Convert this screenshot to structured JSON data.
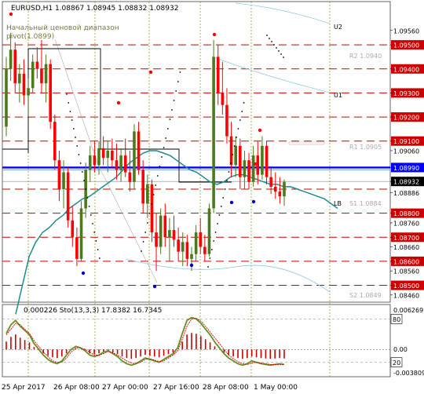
{
  "header": {
    "symbol_line": "EURUSD,H1  1.08867 1.08945 1.08832 1.08932",
    "indicator_name_1": "Начальный ценовой диапазон",
    "indicator_name_2": "pivot(1.0899)"
  },
  "subwindow": {
    "indicator_text": "0.000226  Sto(13,3,3) 17.8382 16.7345",
    "axis_ticks": [
      "0.006269",
      "0.00",
      "-0.003809"
    ],
    "levels": [
      "80",
      "20"
    ]
  },
  "colors": {
    "bull_candle": "#4a7a1a",
    "bear_candle": "#ff0000",
    "ma_teal": "#1e8c8c",
    "level_red": "#cc0000",
    "blue_line": "#0000ff",
    "stoch_main": "#6b8e23",
    "stoch_signal": "#cc0000",
    "fractal_red": "#ff0000",
    "fractal_blue": "#0000cc",
    "gridline": "#8c8c00"
  },
  "chart_data": {
    "type": "candlestick",
    "symbol": "EURUSD",
    "timeframe": "H1",
    "ohlc_last": {
      "open": 1.08867,
      "high": 1.08945,
      "low": 1.08832,
      "close": 1.08932
    },
    "ylim": [
      1.0843,
      1.0968
    ],
    "y_ticks": [
      1.0956,
      1.095,
      1.094,
      1.093,
      1.092,
      1.091,
      1.0906,
      1.0899,
      1.08932,
      1.08886,
      1.088,
      1.0876,
      1.087,
      1.0866,
      1.086,
      1.0856,
      1.085,
      1.0846
    ],
    "y_tick_labels": [
      "1.09560",
      "1.09500",
      "1.09400",
      "1.09300",
      "1.09200",
      "1.09100",
      "1.09060",
      "1.08990",
      "1.08932",
      "1.08886",
      "1.08800",
      "1.08760",
      "1.08700",
      "1.08660",
      "1.08600",
      "1.08560",
      "1.08500",
      "1.08460"
    ],
    "highlighted_ticks": [
      "1.09500",
      "1.09400",
      "1.09300",
      "1.09200",
      "1.09100",
      "1.08800",
      "1.08700",
      "1.08600",
      "1.08500"
    ],
    "blue_tick": "1.08990",
    "dark_tick": "1.08932",
    "x_labels": [
      "25 Apr 2017",
      "26 Apr 08:00",
      "27 Apr 00:00",
      "27 Apr 16:00",
      "28 Apr 08:00",
      "1 May 00:00"
    ],
    "horizontal_levels": [
      1.095,
      1.094,
      1.093,
      1.092,
      1.091,
      1.089,
      1.088,
      1.087,
      1.086,
      1.085
    ],
    "blue_line_level": 1.0899,
    "text_labels": [
      {
        "text": "U2",
        "level": 1.095
      },
      {
        "text": "U1",
        "level": 1.0925
      },
      {
        "text": "LB",
        "level": 1.0882
      },
      {
        "text": "R2 1.0940",
        "level": 1.094
      },
      {
        "text": "R1 1.0905",
        "level": 1.0905
      },
      {
        "text": "S1 1.0884",
        "level": 1.0884
      },
      {
        "text": "S2 1.0849",
        "level": 1.0849
      }
    ],
    "candles": [
      [
        1.0916,
        1.0945,
        1.0912,
        1.094
      ],
      [
        1.094,
        1.0955,
        1.0935,
        1.0948
      ],
      [
        1.0948,
        1.0951,
        1.093,
        1.0934
      ],
      [
        1.0934,
        1.0942,
        1.0926,
        1.0938
      ],
      [
        1.0938,
        1.0944,
        1.0925,
        1.0929
      ],
      [
        1.0929,
        1.0936,
        1.092,
        1.0932
      ],
      [
        1.0932,
        1.0946,
        1.093,
        1.0943
      ],
      [
        1.0943,
        1.0949,
        1.0936,
        1.094
      ],
      [
        1.094,
        1.0952,
        1.093,
        1.0934
      ],
      [
        1.0934,
        1.0946,
        1.0926,
        1.0942
      ],
      [
        1.0942,
        1.0944,
        1.0915,
        1.0918
      ],
      [
        1.0918,
        1.0921,
        1.0898,
        1.0902
      ],
      [
        1.0902,
        1.0906,
        1.0885,
        1.089
      ],
      [
        1.089,
        1.0902,
        1.0882,
        1.0897
      ],
      [
        1.0897,
        1.0899,
        1.0874,
        1.0877
      ],
      [
        1.0877,
        1.0883,
        1.0866,
        1.087
      ],
      [
        1.087,
        1.0874,
        1.0858,
        1.0861
      ],
      [
        1.0861,
        1.0885,
        1.086,
        1.0882
      ],
      [
        1.0882,
        1.0901,
        1.0878,
        1.0898
      ],
      [
        1.0898,
        1.0908,
        1.0893,
        1.0904
      ],
      [
        1.0904,
        1.091,
        1.0897,
        1.09
      ],
      [
        1.09,
        1.091,
        1.0896,
        1.0907
      ],
      [
        1.0907,
        1.0912,
        1.09,
        1.0903
      ],
      [
        1.0903,
        1.091,
        1.0897,
        1.0906
      ],
      [
        1.0906,
        1.0911,
        1.0899,
        1.0902
      ],
      [
        1.0902,
        1.0909,
        1.0894,
        1.0898
      ],
      [
        1.0898,
        1.0907,
        1.0893,
        1.0904
      ],
      [
        1.0904,
        1.0911,
        1.0895,
        1.0897
      ],
      [
        1.0897,
        1.0906,
        1.0889,
        1.0893
      ],
      [
        1.0893,
        1.0917,
        1.089,
        1.0914
      ],
      [
        1.0914,
        1.0918,
        1.0896,
        1.0898
      ],
      [
        1.0898,
        1.0902,
        1.088,
        1.0884
      ],
      [
        1.0884,
        1.0896,
        1.0878,
        1.0892
      ],
      [
        1.0892,
        1.0894,
        1.0868,
        1.0872
      ],
      [
        1.0872,
        1.088,
        1.0856,
        1.0866
      ],
      [
        1.0866,
        1.0882,
        1.0863,
        1.0879
      ],
      [
        1.0879,
        1.0884,
        1.0866,
        1.087
      ],
      [
        1.087,
        1.0878,
        1.086,
        1.0873
      ],
      [
        1.0873,
        1.0879,
        1.0866,
        1.0869
      ],
      [
        1.0869,
        1.0874,
        1.086,
        1.0864
      ],
      [
        1.0864,
        1.0872,
        1.0858,
        1.0868
      ],
      [
        1.0868,
        1.0871,
        1.0858,
        1.0861
      ],
      [
        1.0861,
        1.0866,
        1.0856,
        1.0863
      ],
      [
        1.0863,
        1.0875,
        1.086,
        1.0872
      ],
      [
        1.0872,
        1.0878,
        1.0863,
        1.0866
      ],
      [
        1.0866,
        1.0871,
        1.086,
        1.0863
      ],
      [
        1.0863,
        1.0884,
        1.0862,
        1.0882
      ],
      [
        1.0882,
        1.0952,
        1.088,
        1.0945
      ],
      [
        1.0945,
        1.095,
        1.0925,
        1.093
      ],
      [
        1.093,
        1.0943,
        1.0921,
        1.0925
      ],
      [
        1.0925,
        1.0932,
        1.0909,
        1.0912
      ],
      [
        1.0912,
        1.0918,
        1.0895,
        1.09
      ],
      [
        1.09,
        1.0912,
        1.0895,
        1.0908
      ],
      [
        1.0908,
        1.0911,
        1.089,
        1.0895
      ],
      [
        1.0895,
        1.0906,
        1.089,
        1.0902
      ],
      [
        1.0902,
        1.0905,
        1.089,
        1.0893
      ],
      [
        1.0893,
        1.0908,
        1.0891,
        1.0904
      ],
      [
        1.0904,
        1.091,
        1.0892,
        1.0896
      ],
      [
        1.0896,
        1.0912,
        1.0894,
        1.0908
      ],
      [
        1.0908,
        1.091,
        1.0892,
        1.0895
      ],
      [
        1.0895,
        1.0899,
        1.0888,
        1.0891
      ],
      [
        1.0891,
        1.0897,
        1.0886,
        1.0889
      ],
      [
        1.0889,
        1.0895,
        1.0884,
        1.0887
      ],
      [
        1.0887,
        1.0894,
        1.0883,
        1.0893
      ]
    ],
    "series": [
      {
        "values": [
          1.0838,
          1.085,
          1.0862,
          1.0868,
          1.0872,
          1.0874,
          1.0877,
          1.0879,
          1.0882,
          1.0884,
          1.0886,
          1.0887,
          1.0889,
          1.0891,
          1.0893,
          1.0895,
          1.0898,
          1.0901,
          1.0903,
          1.0905,
          1.0906,
          1.0906,
          1.0905,
          1.0904,
          1.0902,
          1.09,
          1.0898,
          1.0897,
          1.0895,
          1.0893,
          1.0892,
          1.0893,
          1.0895,
          1.0896,
          1.0896,
          1.0895,
          1.0894,
          1.0893,
          1.0892,
          1.0892,
          1.0891,
          1.0891,
          1.089,
          1.0889,
          1.0888,
          1.0887,
          1.0886,
          1.0884,
          1.0882
        ]
      }
    ],
    "subwindow_macd_range": [
      -0.003809,
      0.006269
    ],
    "stochastic_main": [
      60,
      72,
      78,
      70,
      64,
      58,
      46,
      38,
      30,
      24,
      20,
      18,
      22,
      30,
      38,
      42,
      40,
      36,
      30,
      28,
      30,
      34,
      36,
      32,
      28,
      22,
      18,
      16,
      18,
      22,
      26,
      24,
      22,
      20,
      24,
      28,
      32,
      40,
      60,
      78,
      82,
      80,
      74,
      66,
      58,
      48,
      40,
      32,
      26,
      22,
      18,
      16,
      18,
      22,
      20,
      18,
      17,
      16,
      17,
      18,
      17
    ],
    "stochastic_signal": [
      58,
      66,
      74,
      72,
      66,
      60,
      50,
      42,
      34,
      28,
      22,
      20,
      20,
      26,
      34,
      40,
      40,
      38,
      34,
      30,
      30,
      32,
      35,
      33,
      30,
      26,
      22,
      19,
      18,
      20,
      24,
      25,
      23,
      21,
      22,
      26,
      30,
      36,
      52,
      70,
      80,
      81,
      77,
      70,
      62,
      54,
      46,
      38,
      30,
      25,
      21,
      18,
      17,
      19,
      20,
      19,
      18,
      17,
      17,
      17,
      17
    ]
  }
}
